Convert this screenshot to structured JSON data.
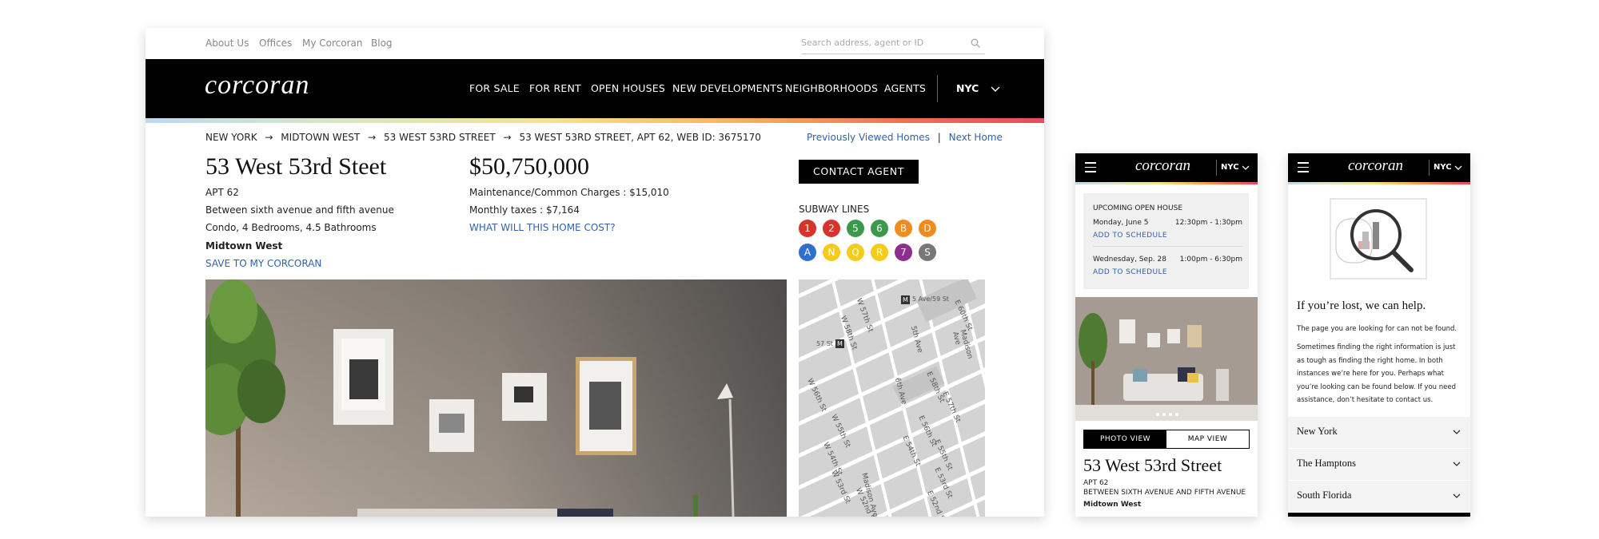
{
  "desktop": {
    "utility_nav": [
      "About Us",
      "Offices",
      "My Corcoran",
      "Blog"
    ],
    "search_placeholder": "Search address, agent or ID",
    "logo_text": "corcoran",
    "main_nav": [
      "FOR SALE",
      "FOR RENT",
      "OPEN HOUSES",
      "NEW DEVELOPMENTS",
      "NEIGHBORHOODS",
      "AGENTS"
    ],
    "region": "NYC",
    "breadcrumb": [
      "NEW YORK",
      "MIDTOWN WEST",
      "53 WEST 53RD STREET",
      "53 WEST 53RD STREET, APT 62, WEB ID: 3675170"
    ],
    "prev_viewed": "Previously Viewed Homes",
    "next_home": "Next Home",
    "listing": {
      "title": "53 West 53rd Steet",
      "apt": "APT 62",
      "cross_streets": "Between sixth avenue and fifth avenue",
      "details": "Condo, 4 Bedrooms, 4.5 Bathrooms",
      "neighborhood": "Midtown West",
      "save_link": "SAVE TO MY CORCORAN",
      "price": "$50,750,000",
      "maintenance": "Maintenance/Common Charges : $15,010",
      "taxes": "Monthly taxes : $7,164",
      "cost_link": "WHAT WILL THIS HOME COST?",
      "contact_button": "CONTACT AGENT",
      "subway_heading": "SUBWAY LINES"
    },
    "subway_lines": [
      {
        "label": "1",
        "color": "#d6332a"
      },
      {
        "label": "2",
        "color": "#d6332a"
      },
      {
        "label": "5",
        "color": "#3a9a4a"
      },
      {
        "label": "6",
        "color": "#3a9a4a"
      },
      {
        "label": "B",
        "color": "#f08c1e"
      },
      {
        "label": "D",
        "color": "#f08c1e"
      },
      {
        "label": "A",
        "color": "#2f6fd0"
      },
      {
        "label": "N",
        "color": "#f5cc1c"
      },
      {
        "label": "Q",
        "color": "#f5cc1c"
      },
      {
        "label": "R",
        "color": "#f5cc1c"
      },
      {
        "label": "7",
        "color": "#8e2f8e"
      },
      {
        "label": "S",
        "color": "#777777"
      }
    ],
    "map_labels": [
      "W 58th St",
      "W 57th St",
      "W 56th St",
      "W 55th St",
      "W 54th St",
      "W 53rd St",
      "W 52nd St",
      "E 58th St",
      "E 57th St",
      "E 56th St",
      "E 55th St",
      "E 54th St",
      "E 53rd St",
      "E 52nd St",
      "Madison Ave",
      "Madison Ave",
      "E 60th St",
      "6th Ave",
      "5th Ave",
      "57 St",
      "5 Ave/59 St"
    ]
  },
  "mobile1": {
    "logo_text": "corcoran",
    "region": "NYC",
    "open_house_heading": "UPCOMING OPEN HOUSE",
    "open_houses": [
      {
        "date": "Monday, June 5",
        "time": "12:30pm - 1:30pm",
        "action": "ADD TO SCHEDULE"
      },
      {
        "date": "Wednesday, Sep. 28",
        "time": "1:00pm - 6:30pm",
        "action": "ADD TO SCHEDULE"
      }
    ],
    "photo_view": "PHOTO VIEW",
    "map_view": "MAP VIEW",
    "title": "53 West 53rd Street",
    "apt": "APT 62",
    "cross_streets": "BETWEEN SIXTH AVENUE AND FIFTH AVENUE",
    "neighborhood": "Midtown West"
  },
  "mobile2": {
    "logo_text": "corcoran",
    "region": "NYC",
    "heading": "If you’re lost, we can help.",
    "line1": "The page you are looking for can not be found.",
    "paragraph": "Sometimes finding the right information is just as tough as finding the right home. In both instances we’re here for you. Perhaps what you’re looking can be found below. If you need assistance, don’t hesitate to contact us.",
    "regions": [
      "New York",
      "The Hamptons",
      "South Florida"
    ]
  }
}
